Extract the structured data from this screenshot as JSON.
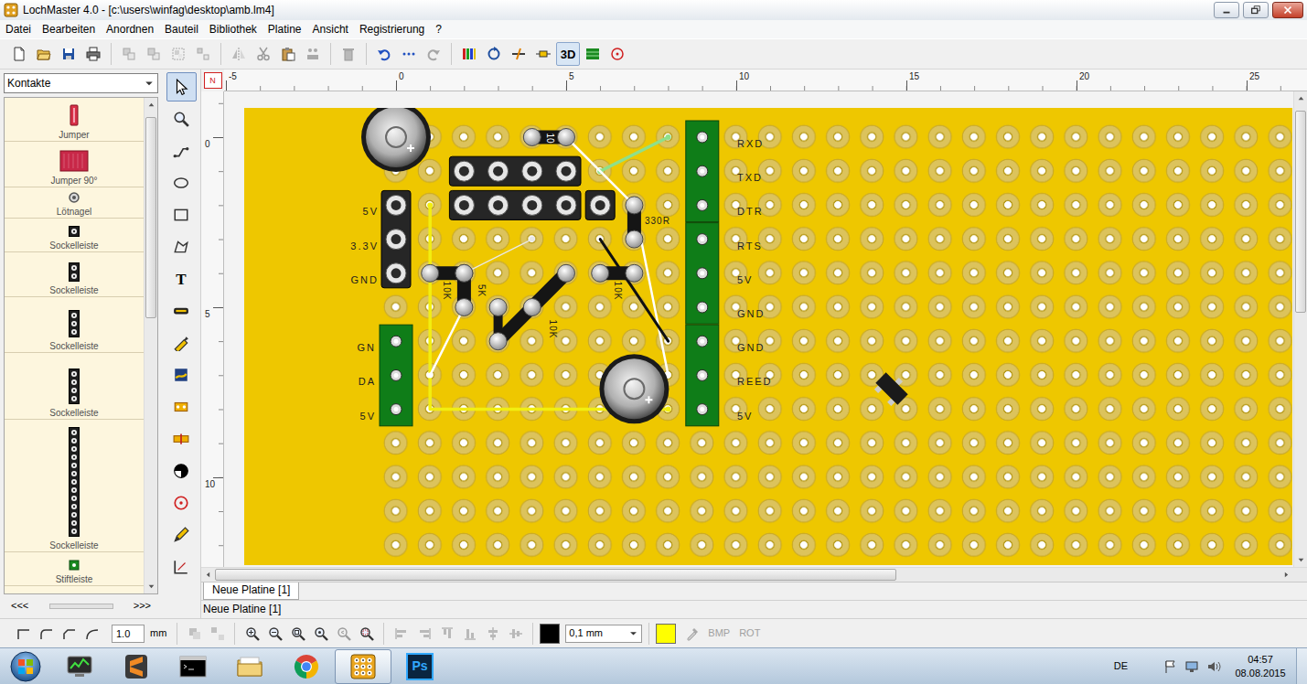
{
  "window": {
    "title": "LochMaster 4.0 - [c:\\users\\winfag\\desktop\\amb.lm4]"
  },
  "menu": [
    "Datei",
    "Bearbeiten",
    "Anordnen",
    "Bauteil",
    "Bibliothek",
    "Platine",
    "Ansicht",
    "Registrierung",
    "?"
  ],
  "toolbar": [
    [
      {
        "kind": "new",
        "disabled": false
      },
      {
        "kind": "open",
        "disabled": false
      },
      {
        "kind": "save",
        "disabled": false
      },
      {
        "kind": "print",
        "disabled": false
      }
    ],
    [
      {
        "kind": "group1",
        "disabled": true
      },
      {
        "kind": "group2",
        "disabled": true
      },
      {
        "kind": "group3",
        "disabled": true
      },
      {
        "kind": "group4",
        "disabled": true
      }
    ],
    [
      {
        "kind": "mirror",
        "disabled": true
      },
      {
        "kind": "cut",
        "disabled": true
      },
      {
        "kind": "paste",
        "disabled": false
      },
      {
        "kind": "people",
        "disabled": true
      }
    ],
    [
      {
        "kind": "trash",
        "disabled": true
      }
    ],
    [
      {
        "kind": "undo",
        "disabled": false
      },
      {
        "kind": "dots",
        "disabled": false
      },
      {
        "kind": "redo",
        "disabled": true
      }
    ],
    [
      {
        "kind": "colors",
        "disabled": false
      },
      {
        "kind": "rotate",
        "disabled": false
      },
      {
        "kind": "strike",
        "disabled": false
      },
      {
        "kind": "resistor",
        "disabled": false
      },
      {
        "label": "3D",
        "selected": true,
        "disabled": false
      },
      {
        "kind": "grid",
        "disabled": false
      },
      {
        "kind": "target",
        "disabled": false
      }
    ]
  ],
  "library": {
    "category": "Kontakte",
    "items": [
      {
        "label": "Jumper",
        "kind": "jumper"
      },
      {
        "label": "Jumper 90°",
        "kind": "jumper90"
      },
      {
        "label": "Lötnagel",
        "kind": "nail"
      },
      {
        "label": "Sockelleiste",
        "kind": "socket1"
      },
      {
        "label": "Sockelleiste",
        "kind": "socket2"
      },
      {
        "label": "Sockelleiste",
        "kind": "socket3"
      },
      {
        "label": "Sockelleiste",
        "kind": "socket4"
      },
      {
        "label": "Sockelleiste",
        "kind": "socket13"
      },
      {
        "label": "Stiftleiste",
        "kind": "pin"
      }
    ],
    "scroll": {
      "level": 0.43
    },
    "nav": [
      "<<<",
      ">>>"
    ]
  },
  "tools": [
    {
      "kind": "select",
      "selected": true
    },
    {
      "kind": "zoom",
      "selected": false
    },
    {
      "kind": "wire",
      "selected": false
    },
    {
      "kind": "ellipse",
      "selected": false
    },
    {
      "kind": "rect",
      "selected": false
    },
    {
      "kind": "polygon",
      "selected": false
    },
    {
      "kind": "text",
      "label": "T",
      "selected": false
    },
    {
      "kind": "bridge",
      "selected": false
    },
    {
      "kind": "probe",
      "selected": false
    },
    {
      "kind": "flag",
      "selected": false
    },
    {
      "kind": "strip",
      "selected": false
    },
    {
      "kind": "cutstrip",
      "selected": false
    },
    {
      "kind": "fill",
      "selected": false
    },
    {
      "kind": "target",
      "selected": false
    },
    {
      "kind": "pencil",
      "selected": false
    },
    {
      "kind": "measure",
      "selected": false
    }
  ],
  "ruler": {
    "corner": "N",
    "top": [
      "-5",
      "0",
      "5",
      "10",
      "15",
      "20",
      "25"
    ],
    "left": [
      "0",
      "5",
      "10"
    ]
  },
  "board": {
    "socket_labels": [
      "5V",
      "3.3V",
      "GND"
    ],
    "input_labels": [
      "GN",
      "DA",
      "5V"
    ],
    "port_labels": [
      "RXD",
      "TXD",
      "DTR",
      "RTS",
      "5V",
      "GND",
      "GND",
      "REED",
      "5V"
    ],
    "resistors": [
      "10",
      "330R",
      "10K",
      "5K",
      "10K",
      "10K"
    ]
  },
  "scrollbars": {
    "vertical": {
      "level": 0.45
    },
    "horizontal": {
      "level": 0.64
    }
  },
  "tabs": [
    {
      "label": "Neue Platine [1]",
      "selected": true
    }
  ],
  "status_bar": "Neue Platine [1]",
  "bottom_toolbar": {
    "corners": [
      {
        "kind": "corner1"
      },
      {
        "kind": "corner2"
      },
      {
        "kind": "corner3"
      },
      {
        "kind": "corner4"
      }
    ],
    "line_width": "1.0",
    "unit": "mm",
    "groups": [
      {
        "kind": "group",
        "disabled": true
      },
      {
        "kind": "ungroup",
        "disabled": true
      }
    ],
    "zoom": [
      {
        "kind": "zoomin",
        "disabled": false
      },
      {
        "kind": "zoomout",
        "disabled": false
      },
      {
        "kind": "zoomfit",
        "disabled": false
      },
      {
        "kind": "zoomall",
        "disabled": false
      },
      {
        "kind": "zoomprev",
        "disabled": true
      },
      {
        "kind": "zoomsel",
        "disabled": false
      }
    ],
    "align": [
      {
        "kind": "align1",
        "disabled": true
      },
      {
        "kind": "align2",
        "disabled": true
      },
      {
        "kind": "align3",
        "disabled": true
      },
      {
        "kind": "align4",
        "disabled": true
      },
      {
        "kind": "align5",
        "disabled": true
      },
      {
        "kind": "align6",
        "disabled": true
      }
    ],
    "line_color": "#000000",
    "stroke": "0,1 mm",
    "fill_color": "#ffff00",
    "actions": [
      {
        "kind": "pipette",
        "disabled": true
      },
      {
        "kind": "text",
        "label": "BMP",
        "disabled": true
      },
      {
        "kind": "text",
        "label": "ROT",
        "disabled": true
      }
    ]
  },
  "taskbar": {
    "apps": [
      {
        "kind": "taskmgr",
        "selected": false
      },
      {
        "kind": "sublime",
        "selected": false
      },
      {
        "kind": "cmd",
        "selected": false
      },
      {
        "kind": "explorer",
        "selected": false
      },
      {
        "kind": "chrome",
        "selected": false
      },
      {
        "kind": "lochmaster",
        "selected": true
      },
      {
        "kind": "photoshop",
        "label": "Ps",
        "selected": false
      }
    ],
    "language": "DE",
    "tray": [
      {
        "kind": "flag"
      },
      {
        "kind": "network"
      },
      {
        "kind": "speaker"
      }
    ],
    "time": "04:57",
    "date": "08.08.2015"
  }
}
